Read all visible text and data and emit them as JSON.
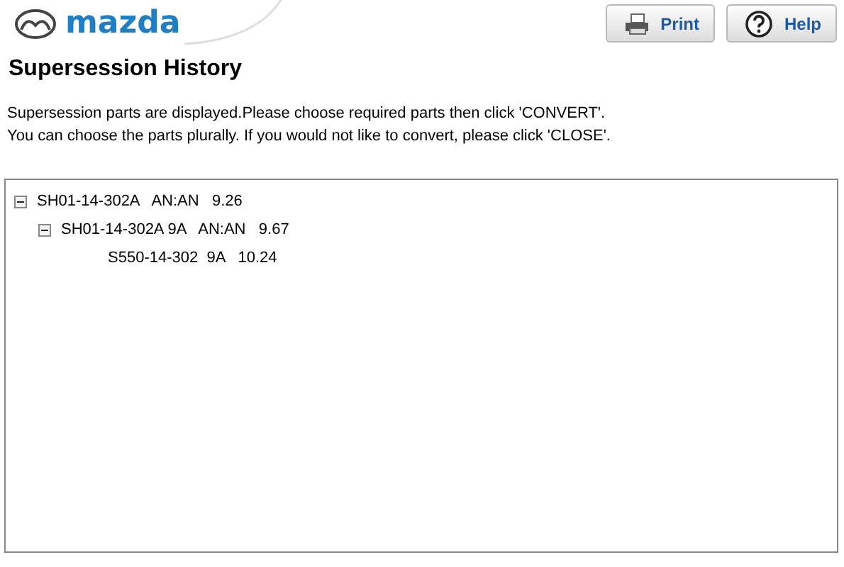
{
  "header": {
    "logo_text": "mazda",
    "buttons": [
      {
        "label": "Print",
        "kind": "print"
      },
      {
        "label": "Help",
        "kind": "help"
      }
    ]
  },
  "title": "Supersession History",
  "instructions": [
    "Supersession parts are displayed.Please choose required parts then click 'CONVERT'.",
    "You can choose the parts plurally. If you would not like to convert, please click 'CLOSE'."
  ],
  "tree": [
    {
      "label": "SH01-14-302A   AN:AN   9.26",
      "expanded": true,
      "children": [
        {
          "label": "SH01-14-302A 9A   AN:AN   9.67",
          "expanded": true,
          "children": [
            {
              "label": "S550-14-302  9A   10.24"
            }
          ]
        }
      ]
    }
  ]
}
